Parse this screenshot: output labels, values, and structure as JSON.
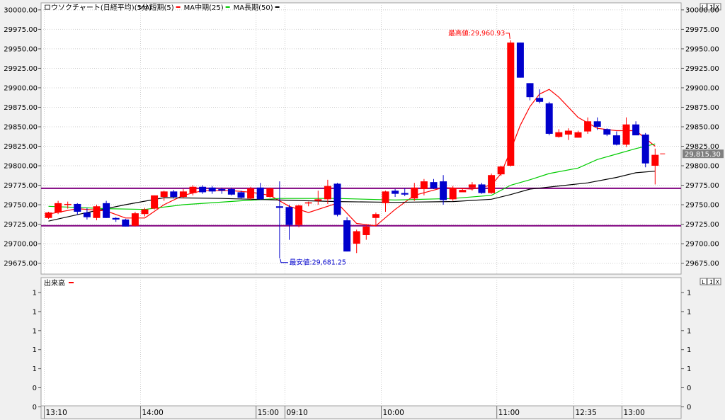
{
  "title": "ロウソクチャート(日経平均)(5分)",
  "legend": [
    {
      "label": "MA短期(5)",
      "color": "#ff0000"
    },
    {
      "label": "MA中期(25)",
      "color": "#00cc00"
    },
    {
      "label": "MA長期(50)",
      "color": "#000000"
    }
  ],
  "volume_title": "出来高",
  "window_buttons": [
    "L",
    "I",
    "X"
  ],
  "colors": {
    "up": "#ff0000",
    "down": "#0000cc",
    "hline": "#800080",
    "price_label_bg": "#808080",
    "high_annotation": "#ff0000",
    "low_annotation": "#0000cc"
  },
  "chart_data": {
    "type": "candlestick",
    "y_ticks": [
      "30000.00",
      "29975.00",
      "29950.00",
      "29925.00",
      "29900.00",
      "29875.00",
      "29850.00",
      "29825.00",
      "29800.00",
      "29775.00",
      "29750.00",
      "29725.00",
      "29700.00",
      "29675.00"
    ],
    "ylim": [
      29661.0,
      30009.0
    ],
    "x_ticks": [
      {
        "label": "13:10",
        "index": 0
      },
      {
        "label": "14:00",
        "index": 10
      },
      {
        "label": "15:00",
        "index": 22
      },
      {
        "label": "09:10",
        "index": 25
      },
      {
        "label": "10:00",
        "index": 35
      },
      {
        "label": "11:00",
        "index": 47
      },
      {
        "label": "12:35",
        "index": 55
      },
      {
        "label": "13:00",
        "index": 60
      }
    ],
    "candles": [
      {
        "o": 29733,
        "h": 29741,
        "l": 29732,
        "c": 29740
      },
      {
        "o": 29740,
        "h": 29755,
        "l": 29738,
        "c": 29752
      },
      {
        "o": 29750,
        "h": 29754,
        "l": 29745,
        "c": 29751
      },
      {
        "o": 29751,
        "h": 29752,
        "l": 29737,
        "c": 29741
      },
      {
        "o": 29740,
        "h": 29746,
        "l": 29731,
        "c": 29734
      },
      {
        "o": 29733,
        "h": 29750,
        "l": 29730,
        "c": 29748
      },
      {
        "o": 29752,
        "h": 29755,
        "l": 29733,
        "c": 29733
      },
      {
        "o": 29733,
        "h": 29734,
        "l": 29728,
        "c": 29731
      },
      {
        "o": 29731,
        "h": 29732,
        "l": 29722,
        "c": 29722
      },
      {
        "o": 29723,
        "h": 29741,
        "l": 29722,
        "c": 29739
      },
      {
        "o": 29738,
        "h": 29746,
        "l": 29735,
        "c": 29744
      },
      {
        "o": 29745,
        "h": 29762,
        "l": 29744,
        "c": 29762
      },
      {
        "o": 29760,
        "h": 29768,
        "l": 29755,
        "c": 29767
      },
      {
        "o": 29767,
        "h": 29769,
        "l": 29758,
        "c": 29760
      },
      {
        "o": 29760,
        "h": 29770,
        "l": 29758,
        "c": 29767
      },
      {
        "o": 29765,
        "h": 29775,
        "l": 29762,
        "c": 29773
      },
      {
        "o": 29773,
        "h": 29775,
        "l": 29764,
        "c": 29766
      },
      {
        "o": 29772,
        "h": 29774,
        "l": 29764,
        "c": 29767
      },
      {
        "o": 29770,
        "h": 29772,
        "l": 29764,
        "c": 29768
      },
      {
        "o": 29770,
        "h": 29772,
        "l": 29762,
        "c": 29763
      },
      {
        "o": 29766,
        "h": 29768,
        "l": 29758,
        "c": 29759
      },
      {
        "o": 29758,
        "h": 29773,
        "l": 29756,
        "c": 29771
      },
      {
        "o": 29772,
        "h": 29778,
        "l": 29756,
        "c": 29757
      },
      {
        "o": 29760,
        "h": 29772,
        "l": 29759,
        "c": 29771
      },
      {
        "o": 29748,
        "h": 29780,
        "l": 29681.25,
        "c": 29746
      },
      {
        "o": 29747,
        "h": 29750,
        "l": 29705,
        "c": 29724
      },
      {
        "o": 29724,
        "h": 29750,
        "l": 29721,
        "c": 29749
      },
      {
        "o": 29752,
        "h": 29754,
        "l": 29748,
        "c": 29753
      },
      {
        "o": 29755,
        "h": 29768,
        "l": 29750,
        "c": 29757
      },
      {
        "o": 29757,
        "h": 29782,
        "l": 29751,
        "c": 29774
      },
      {
        "o": 29777,
        "h": 29778,
        "l": 29735,
        "c": 29737
      },
      {
        "o": 29730,
        "h": 29734,
        "l": 29690,
        "c": 29690
      },
      {
        "o": 29700,
        "h": 29718,
        "l": 29688,
        "c": 29716
      },
      {
        "o": 29711,
        "h": 29724,
        "l": 29705,
        "c": 29722
      },
      {
        "o": 29733,
        "h": 29740,
        "l": 29722,
        "c": 29738
      },
      {
        "o": 29752,
        "h": 29768,
        "l": 29741,
        "c": 29767
      },
      {
        "o": 29768,
        "h": 29770,
        "l": 29760,
        "c": 29764
      },
      {
        "o": 29765,
        "h": 29771,
        "l": 29761,
        "c": 29763
      },
      {
        "o": 29758,
        "h": 29778,
        "l": 29755,
        "c": 29772
      },
      {
        "o": 29770,
        "h": 29783,
        "l": 29762,
        "c": 29780
      },
      {
        "o": 29779,
        "h": 29783,
        "l": 29770,
        "c": 29771
      },
      {
        "o": 29780,
        "h": 29788,
        "l": 29750,
        "c": 29756
      },
      {
        "o": 29757,
        "h": 29774,
        "l": 29755,
        "c": 29771
      },
      {
        "o": 29766,
        "h": 29771,
        "l": 29768,
        "c": 29769
      },
      {
        "o": 29772,
        "h": 29779,
        "l": 29768,
        "c": 29776
      },
      {
        "o": 29776,
        "h": 29778,
        "l": 29764,
        "c": 29765
      },
      {
        "o": 29765,
        "h": 29790,
        "l": 29764,
        "c": 29788
      },
      {
        "o": 29789,
        "h": 29800,
        "l": 29787,
        "c": 29799
      },
      {
        "o": 29800,
        "h": 29960.93,
        "l": 29799,
        "c": 29958
      },
      {
        "o": 29958,
        "h": 29958,
        "l": 29913,
        "c": 29913
      },
      {
        "o": 29906,
        "h": 29906,
        "l": 29884,
        "c": 29888
      },
      {
        "o": 29887,
        "h": 29898,
        "l": 29880,
        "c": 29882
      },
      {
        "o": 29880,
        "h": 29882,
        "l": 29839,
        "c": 29841
      },
      {
        "o": 29837,
        "h": 29847,
        "l": 29836,
        "c": 29843
      },
      {
        "o": 29840,
        "h": 29848,
        "l": 29833,
        "c": 29845
      },
      {
        "o": 29836,
        "h": 29845,
        "l": 29836,
        "c": 29843
      },
      {
        "o": 29844,
        "h": 29862,
        "l": 29841,
        "c": 29857
      },
      {
        "o": 29857,
        "h": 29862,
        "l": 29846,
        "c": 29850
      },
      {
        "o": 29847,
        "h": 29848,
        "l": 29838,
        "c": 29840
      },
      {
        "o": 29839,
        "h": 29844,
        "l": 29826,
        "c": 29827
      },
      {
        "o": 29827,
        "h": 29862,
        "l": 29824,
        "c": 29853
      },
      {
        "o": 29853,
        "h": 29857,
        "l": 29840,
        "c": 29839
      },
      {
        "o": 29840,
        "h": 29842,
        "l": 29798,
        "c": 29803
      },
      {
        "o": 29800,
        "h": 29822,
        "l": 29776,
        "c": 29814
      }
    ],
    "ma": [
      {
        "name": "MA短期(5)",
        "color": "#ff0000",
        "points": [
          [
            0,
            29738
          ],
          [
            3,
            29745
          ],
          [
            6,
            29742
          ],
          [
            8,
            29733
          ],
          [
            10,
            29733
          ],
          [
            12,
            29750
          ],
          [
            14,
            29762
          ],
          [
            16,
            29768
          ],
          [
            19,
            29768
          ],
          [
            21,
            29766
          ],
          [
            23,
            29762
          ],
          [
            25,
            29748
          ],
          [
            27,
            29740
          ],
          [
            30,
            29752
          ],
          [
            32,
            29726
          ],
          [
            34,
            29723
          ],
          [
            36,
            29744
          ],
          [
            38,
            29762
          ],
          [
            41,
            29772
          ],
          [
            44,
            29770
          ],
          [
            46,
            29775
          ],
          [
            47,
            29790
          ],
          [
            48,
            29820
          ],
          [
            49,
            29852
          ],
          [
            50,
            29876
          ],
          [
            51,
            29892
          ],
          [
            52,
            29898
          ],
          [
            53,
            29888
          ],
          [
            55,
            29862
          ],
          [
            57,
            29848
          ],
          [
            59,
            29845
          ],
          [
            61,
            29845
          ],
          [
            62,
            29835
          ],
          [
            63,
            29825
          ]
        ]
      },
      {
        "name": "MA中期(25)",
        "color": "#00cc00",
        "points": [
          [
            0,
            29748
          ],
          [
            6,
            29745
          ],
          [
            10,
            29744
          ],
          [
            14,
            29750
          ],
          [
            20,
            29755
          ],
          [
            24,
            29758
          ],
          [
            30,
            29758
          ],
          [
            36,
            29756
          ],
          [
            42,
            29758
          ],
          [
            46,
            29762
          ],
          [
            48,
            29775
          ],
          [
            50,
            29782
          ],
          [
            52,
            29790
          ],
          [
            55,
            29797
          ],
          [
            57,
            29808
          ],
          [
            59,
            29815
          ],
          [
            61,
            29822
          ],
          [
            63,
            29828
          ]
        ]
      },
      {
        "name": "MA長期(50)",
        "color": "#000000",
        "points": [
          [
            0,
            29729
          ],
          [
            4,
            29740
          ],
          [
            8,
            29750
          ],
          [
            12,
            29759
          ],
          [
            18,
            29758
          ],
          [
            24,
            29756
          ],
          [
            30,
            29754
          ],
          [
            36,
            29753
          ],
          [
            42,
            29754
          ],
          [
            46,
            29757
          ],
          [
            48,
            29763
          ],
          [
            50,
            29770
          ],
          [
            53,
            29774
          ],
          [
            56,
            29778
          ],
          [
            59,
            29785
          ],
          [
            61,
            29791
          ],
          [
            63,
            29793
          ]
        ]
      }
    ],
    "hlines": [
      29771,
      29723
    ],
    "current_price": "29,815.30",
    "current_value": 29815.3,
    "annotations": [
      {
        "label": "最高値:29,960.93",
        "value": 29960.93,
        "index": 48,
        "kind": "high"
      },
      {
        "label": "最安値:29,681.25",
        "value": 29681.25,
        "index": 24,
        "kind": "low"
      }
    ],
    "volume_ticks": [
      "1",
      "1",
      "1",
      "1",
      "1",
      "0",
      "0",
      "0"
    ]
  }
}
